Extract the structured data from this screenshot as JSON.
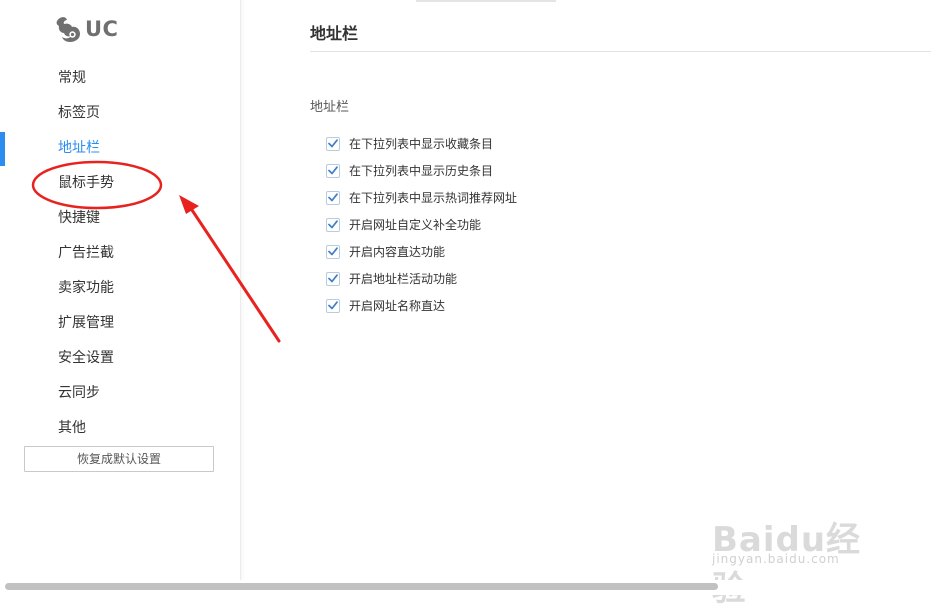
{
  "app": {
    "logo_text": "UC"
  },
  "sidebar": {
    "active_index": 2,
    "items": [
      {
        "label": "常规"
      },
      {
        "label": "标签页"
      },
      {
        "label": "地址栏"
      },
      {
        "label": "鼠标手势"
      },
      {
        "label": "快捷键"
      },
      {
        "label": "广告拦截"
      },
      {
        "label": "卖家功能"
      },
      {
        "label": "扩展管理"
      },
      {
        "label": "安全设置"
      },
      {
        "label": "云同步"
      },
      {
        "label": "其他"
      }
    ],
    "reset_label": "恢复成默认设置"
  },
  "main": {
    "title": "地址栏",
    "section_label": "地址栏",
    "options": [
      {
        "label": "在下拉列表中显示收藏条目",
        "checked": true
      },
      {
        "label": "在下拉列表中显示历史条目",
        "checked": true
      },
      {
        "label": "在下拉列表中显示热词推荐网址",
        "checked": true
      },
      {
        "label": "开启网址自定义补全功能",
        "checked": true
      },
      {
        "label": "开启内容直达功能",
        "checked": true
      },
      {
        "label": "开启地址栏活动功能",
        "checked": true
      },
      {
        "label": "开启网址名称直达",
        "checked": true
      }
    ]
  },
  "watermark": {
    "brand": "Baidu经验",
    "url": "jingyan.baidu.com"
  },
  "colors": {
    "accent": "#2d8cf0",
    "annotation": "#e8231f",
    "check": "#3f7fc4"
  },
  "icons": {
    "logo": "uc-squirrel-logo-icon",
    "checkbox": "checkmark-icon"
  }
}
